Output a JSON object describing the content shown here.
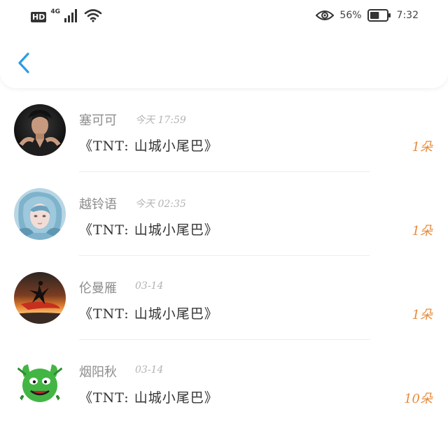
{
  "status_bar": {
    "hd": "HD",
    "network": "4G",
    "battery_percent": "56%",
    "time": "7:32",
    "battery_level": 0.56
  },
  "header": {
    "back_icon": "chevron-left-icon",
    "accent_color": "#2f9be6"
  },
  "list": {
    "items": [
      {
        "name": "塞可可",
        "time": "今天 17:59",
        "title": "《TNT: 山城小尾巴》",
        "count": "1朵",
        "avatar": "avatar-man-dark"
      },
      {
        "name": "越铃语",
        "time": "今天 02:35",
        "title": "《TNT: 山城小尾巴》",
        "count": "1朵",
        "avatar": "avatar-blue-illustration"
      },
      {
        "name": "伦曼雁",
        "time": "03-14",
        "title": "《TNT: 山城小尾巴》",
        "count": "1朵",
        "avatar": "avatar-sunset-dancer"
      },
      {
        "name": "烟阳秋",
        "time": "03-14",
        "title": "《TNT: 山城小尾巴》",
        "count": "10朵",
        "avatar": "avatar-green-cartoon"
      }
    ]
  },
  "colors": {
    "count": "#e98b3a",
    "name": "#8d8d8d",
    "title": "#333333"
  }
}
